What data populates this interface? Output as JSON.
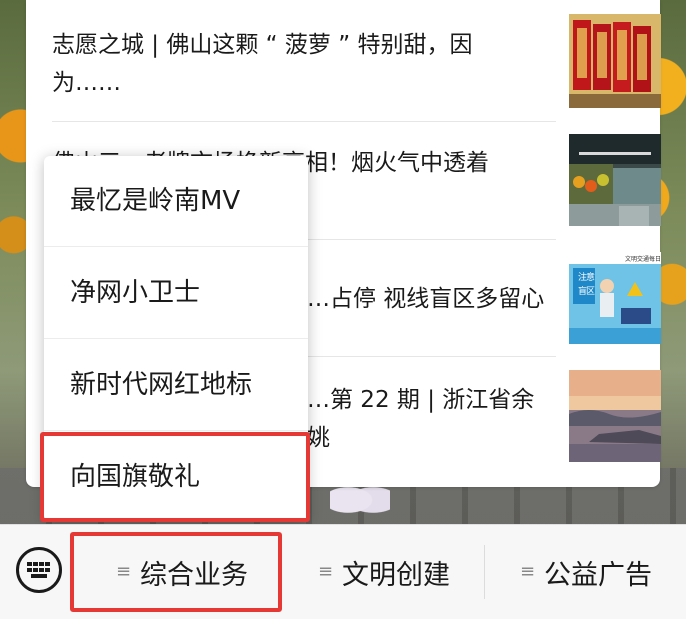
{
  "news": {
    "items": [
      {
        "title": "志愿之城 | 佛山这颗 “ 菠萝 ” 特别甜，因为……",
        "thumb_icon": "red-banners-photo"
      },
      {
        "title": "佛山三…老牌市场换新亮相！烟火气中透着",
        "thumb_icon": "market-interior-photo"
      },
      {
        "title": "…占停 视线盲区多留心",
        "thumb_icon": "traffic-poster-photo"
      },
      {
        "title": "…第 22 期 | 浙江省余姚",
        "thumb_icon": "lakeside-sunset-photo"
      }
    ]
  },
  "popup": {
    "items": [
      "最忆是岭南MV",
      "净网小卫士",
      "新时代网红地标",
      "向国旗敬礼"
    ]
  },
  "thumb_text": {
    "traffic_line1": "注",
    "traffic_line2": "意",
    "traffic_line3": "盲",
    "traffic_line4": "区",
    "traffic_top": "文明交通每日谈"
  },
  "bottom_bar": {
    "keyboard_icon": "keyboard-icon",
    "menus": [
      {
        "label": "综合业务",
        "icon": "menu-lines-icon"
      },
      {
        "label": "文明创建",
        "icon": "menu-lines-icon"
      },
      {
        "label": "公益广告",
        "icon": "menu-lines-icon"
      }
    ]
  },
  "colors": {
    "highlight": "#e53935",
    "background": "#ffffff",
    "bar": "#f7f7f7"
  }
}
